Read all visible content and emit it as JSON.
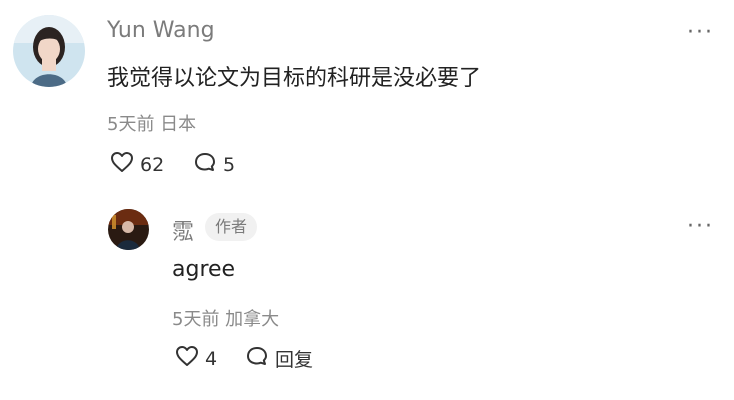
{
  "comment": {
    "author": "Yun Wang",
    "text": "我觉得以论文为目标的科研是没必要了",
    "meta": "5天前 日本",
    "likes": "62",
    "replies": "5",
    "more_label": "···"
  },
  "reply": {
    "author": "霐",
    "badge": "作者",
    "text": "agree",
    "meta": "5天前 加拿大",
    "likes": "4",
    "reply_label": "回复",
    "more_label": "···"
  },
  "icons": {
    "like": "heart-icon",
    "comment": "comment-icon",
    "more": "more-icon"
  },
  "colors": {
    "name": "#7b7b7b",
    "meta": "#8a8a8a",
    "text": "#222222",
    "badge_bg": "#f1f1f1"
  }
}
